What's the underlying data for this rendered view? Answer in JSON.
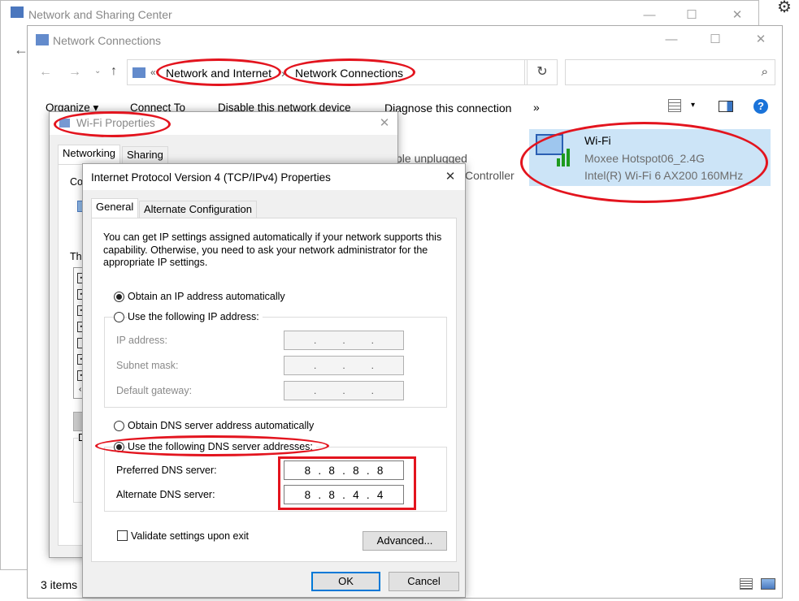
{
  "back_window": {
    "title": "Network and Sharing Center"
  },
  "main_window": {
    "title": "Network Connections",
    "breadcrumb": {
      "separator": "«",
      "part1": "Network and Internet",
      "arrow": "›",
      "part2": "Network Connections"
    },
    "toolbar": {
      "organize": "Organize ▾",
      "connect_to": "Connect To",
      "disable": "Disable this network device",
      "diagnose": "Diagnose this connection",
      "more": "»"
    },
    "items": [
      {
        "name": "Wi-Fi",
        "ssid": "Moxee Hotspot06_2.4G",
        "adapter": "Intel(R) Wi-Fi 6 AX200 160MHz"
      }
    ],
    "partial_texts": {
      "cable": "ble unplugged",
      "controller": "Controller"
    },
    "status_bar": {
      "count": "3 items"
    }
  },
  "wifi_props": {
    "title": "Wi-Fi Properties",
    "tabs": [
      "Networking",
      "Sharing"
    ],
    "partial_co": "Co",
    "partial_th": "Th",
    "partial_d": "D"
  },
  "ipv4": {
    "title": "Internet Protocol Version 4 (TCP/IPv4) Properties",
    "tabs": [
      "General",
      "Alternate Configuration"
    ],
    "description": "You can get IP settings assigned automatically if your network supports this capability. Otherwise, you need to ask your network administrator for the appropriate IP settings.",
    "ip_auto": "Obtain an IP address automatically",
    "ip_manual": "Use the following IP address:",
    "ip_fields": [
      {
        "label": "IP address:",
        "value": ". . ."
      },
      {
        "label": "Subnet mask:",
        "value": ". . ."
      },
      {
        "label": "Default gateway:",
        "value": ". . ."
      }
    ],
    "dns_auto": "Obtain DNS server address automatically",
    "dns_manual": "Use the following DNS server addresses:",
    "preferred_label": "Preferred DNS server:",
    "preferred_octets": [
      "8",
      ".",
      "8",
      ".",
      "8",
      ".",
      "8"
    ],
    "alternate_label": "Alternate DNS server:",
    "alternate_octets": [
      "8",
      ".",
      "8",
      ".",
      "4",
      ".",
      "4"
    ],
    "validate": "Validate settings upon exit",
    "advanced": "Advanced...",
    "ok": "OK",
    "cancel": "Cancel"
  },
  "colors": {
    "annotation": "#e3141e",
    "accent": "#0078d7"
  }
}
